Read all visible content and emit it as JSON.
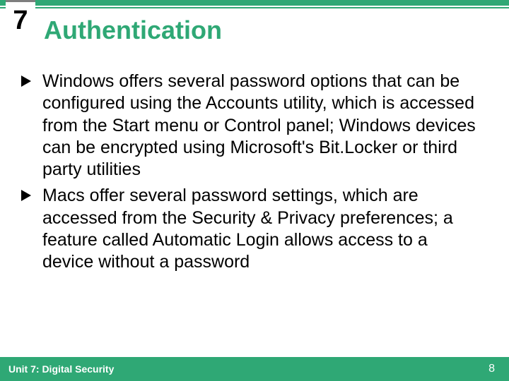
{
  "chapter_number": "7",
  "title": "Authentication",
  "bullets": [
    "Windows offers several password options that can be configured using the Accounts utility, which is accessed from the Start menu or Control panel; Windows devices can be encrypted using Microsoft's Bit.Locker or third party utilities",
    "Macs offer several password settings, which are accessed from the Security & Privacy preferences; a feature called Automatic Login allows access to a device without a password"
  ],
  "footer": {
    "unit_label": "Unit 7: Digital Security",
    "page_number": "8"
  },
  "colors": {
    "accent": "#2fa875"
  }
}
